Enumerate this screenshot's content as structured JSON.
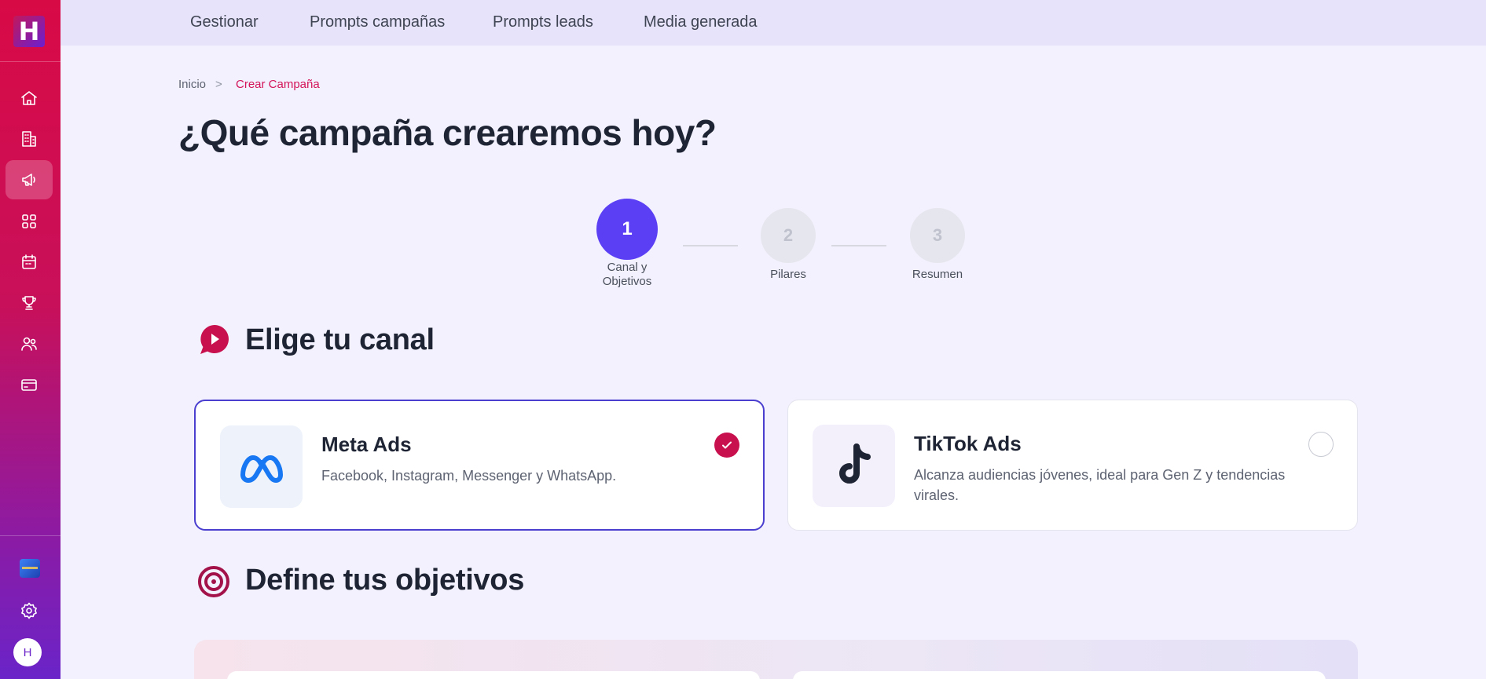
{
  "app": {
    "logo_letter": "H",
    "avatar_letter": "H"
  },
  "topnav": {
    "items": [
      "Gestionar",
      "Prompts campañas",
      "Prompts leads",
      "Media generada"
    ]
  },
  "breadcrumb": {
    "home": "Inicio",
    "separator": ">",
    "current": "Crear Campaña"
  },
  "page": {
    "title": "¿Qué campaña crearemos hoy?"
  },
  "stepper": {
    "steps": [
      {
        "number": "1",
        "label": "Canal y Objetivos",
        "state": "active"
      },
      {
        "number": "2",
        "label": "Pilares",
        "state": "pending"
      },
      {
        "number": "3",
        "label": "Resumen",
        "state": "pending"
      }
    ]
  },
  "channel_section": {
    "title": "Elige tu canal",
    "icon": "chat-play-icon"
  },
  "channels": [
    {
      "name": "Meta Ads",
      "description": "Facebook, Instagram, Messenger y WhatsApp.",
      "selected": true,
      "icon": "meta-logo-icon"
    },
    {
      "name": "TikTok Ads",
      "description": "Alcanza audiencias jóvenes, ideal para Gen Z y tendencias virales.",
      "selected": false,
      "icon": "tiktok-logo-icon"
    }
  ],
  "objectives_section": {
    "title": "Define tus objetivos",
    "icon": "target-icon"
  },
  "colors": {
    "primary": "#5b3ff5",
    "accent": "#d4145a",
    "selected_border": "#4b3fd0",
    "check": "#c8104f"
  }
}
